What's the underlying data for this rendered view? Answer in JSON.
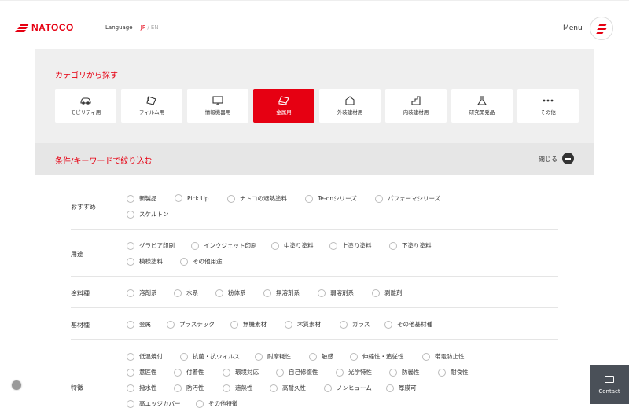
{
  "header": {
    "logo_text": "NATOCO",
    "language_label": "Language",
    "lang_jp": "JP",
    "lang_sep": "/",
    "lang_en": "EN",
    "menu_label": "Menu"
  },
  "categories": {
    "title": "カテゴリから探す",
    "items": [
      {
        "label": "モビリティ用",
        "icon": "car-icon"
      },
      {
        "label": "フィルム用",
        "icon": "film-icon"
      },
      {
        "label": "情報機器用",
        "icon": "monitor-icon"
      },
      {
        "label": "金属用",
        "icon": "metal-icon",
        "active": true
      },
      {
        "label": "外装建材用",
        "icon": "house-icon"
      },
      {
        "label": "内装建材用",
        "icon": "stairs-icon"
      },
      {
        "label": "研究開発品",
        "icon": "flask-icon"
      },
      {
        "label": "その他",
        "icon": "more-icon"
      }
    ]
  },
  "filter": {
    "title": "条件/キーワードで絞り込む",
    "close_label": "閉じる",
    "rows": [
      {
        "label": "おすすめ",
        "options": [
          "新製品",
          "Pick Up",
          "ナトコの遮熱塗料",
          "Te-onシリーズ",
          "パフォーマシリーズ",
          "スケルトン"
        ]
      },
      {
        "label": "用途",
        "options": [
          "グラビア印刷",
          "インクジェット印刷",
          "中塗り塗料",
          "上塗り塗料",
          "下塗り塗料",
          "模様塗料",
          "その他用途"
        ]
      },
      {
        "label": "塗料種",
        "options": [
          "溶剤系",
          "水系",
          "粉体系",
          "無溶剤系",
          "弱溶剤系",
          "剥離剤"
        ]
      },
      {
        "label": "基材種",
        "options": [
          "金属",
          "プラスチック",
          "無機素材",
          "木質素材",
          "ガラス",
          "その他基材種"
        ]
      },
      {
        "label": "特徴",
        "options": [
          "低温焼付",
          "抗菌・抗ウィルス",
          "耐摩耗性",
          "触感",
          "伸縮性・追従性",
          "帯電防止性",
          "意匠性",
          "付着性",
          "環境対応",
          "自己修復性",
          "光学特性",
          "防曇性",
          "耐食性",
          "撥水性",
          "防汚性",
          "遮熱性",
          "高耐久性",
          "ノンヒューム",
          "厚膜可",
          "高エッジカバー",
          "その他特徴"
        ]
      }
    ]
  },
  "contact": {
    "label": "Contact"
  }
}
